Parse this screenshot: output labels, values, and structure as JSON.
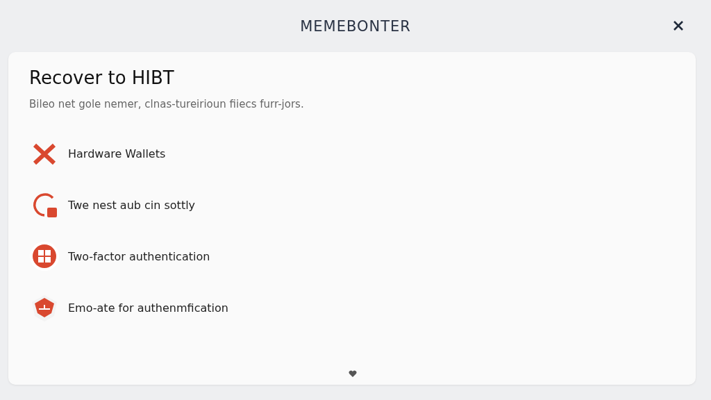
{
  "window": {
    "title": "MEMEBONTER"
  },
  "card": {
    "title": "Recover to HIBT",
    "subtitle": "Bileo net gole nemer, clnas-tureirioun fiiecs furr-jors.",
    "items": [
      {
        "kind": "cross",
        "label": "Hardware Wallets"
      },
      {
        "kind": "refresh",
        "label": "Twe nest aub cin sottly"
      },
      {
        "kind": "grid",
        "label": "Two-factor authentication"
      },
      {
        "kind": "shield",
        "label": "Emo-ate for authenmfication"
      }
    ]
  }
}
